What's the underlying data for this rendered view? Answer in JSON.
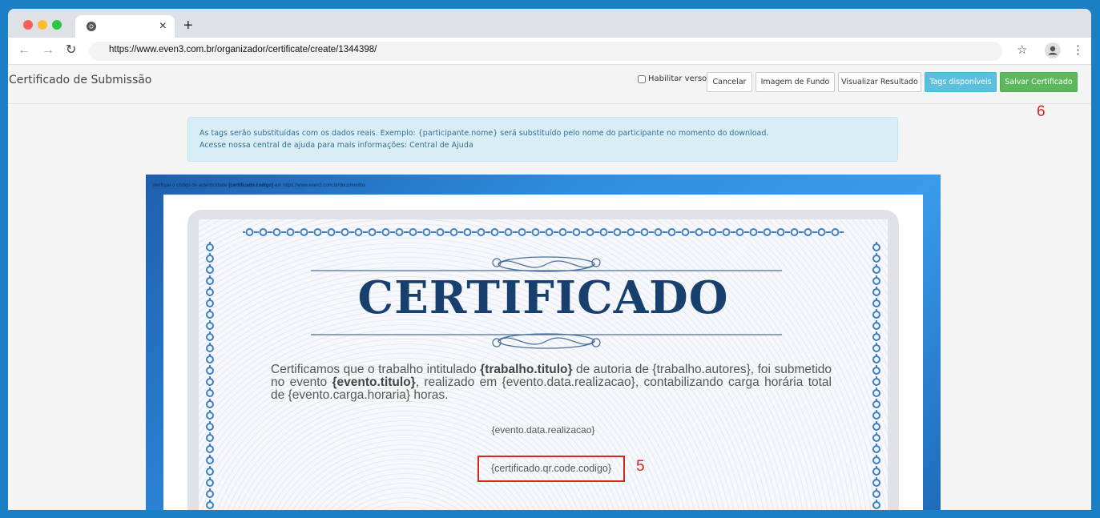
{
  "browser": {
    "tab_close": "×",
    "new_tab": "+",
    "url": "https://www.even3.com.br/organizador/certificate/create/1344398/",
    "icons": [
      "chrome-icon",
      "close-icon",
      "plus-icon",
      "back-icon",
      "forward-icon",
      "reload-icon",
      "star-icon",
      "profile-icon",
      "menu-icon"
    ]
  },
  "header": {
    "title": "Certificado de Submissão",
    "checkbox_label": "Habilitar verso",
    "buttons": {
      "cancel": "Cancelar",
      "background": "Imagem de Fundo",
      "preview": "Visualizar Resultado",
      "tags": "Tags disponíveis",
      "save": "Salvar Certificado"
    }
  },
  "annotations": {
    "save_number": "6",
    "qr_number": "5"
  },
  "alert": {
    "line1": "As tags serão substituídas com os dados reais. Exemplo: {participante.nome} será substituído pelo nome do participante no momento do download.",
    "line2": "Acesse nossa central de ajuda para mais informações: Central de Ajuda"
  },
  "certificate": {
    "verify_prefix": "Verifique o código de autenticidade",
    "verify_tag": "{certificado.codigo}",
    "verify_suffix": "em https://www.even3.com.br/documentos",
    "heading": "CERTIFICADO",
    "body_1": "Certificamos que o trabalho intitulado ",
    "body_tag1": "{trabalho.titulo}",
    "body_2": " de autoria de {trabalho.autores}, foi submetido no evento ",
    "body_tag2": "{evento.titulo}",
    "body_3": ", realizado em {evento.data.realizacao}, contabilizando carga horária total de {evento.carga.horaria} horas.",
    "date": "{evento.data.realizacao}",
    "qr_code": "{certificado.qr.code.codigo}"
  },
  "colors": {
    "desktop": "#1a7fc4",
    "tags_button": "#5bc0de",
    "save_button": "#5cb85c",
    "annotation": "#d9261c",
    "cert_heading": "#18406e"
  }
}
